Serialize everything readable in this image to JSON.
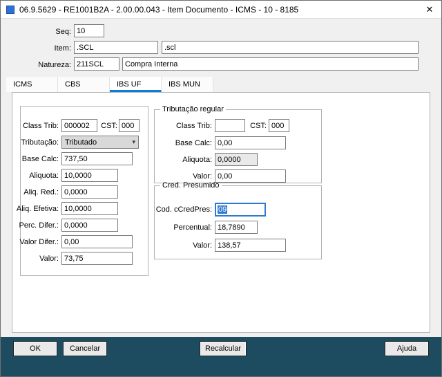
{
  "window": {
    "title": "06.9.5629 - RE1001B2A - 2.00.00.043 - Item Documento - ICMS - 10 - 8185"
  },
  "icons": {
    "close": "✕",
    "dropdown_arrow": "▾"
  },
  "colors": {
    "footer_bg": "#1d4b5f",
    "tab_accent": "#0c7cd8",
    "focus_blue": "#2e7ad1",
    "app_icon_blue": "#2f6fd6"
  },
  "header": {
    "seq": {
      "label": "Seq:",
      "value": "10"
    },
    "item": {
      "label": "Item:",
      "code": ".SCL",
      "description": ".scl"
    },
    "natureza": {
      "label": "Natureza:",
      "code": "211SCL",
      "description": "Compra Interna"
    }
  },
  "tabs": [
    {
      "label": "ICMS",
      "active": false
    },
    {
      "label": "CBS",
      "active": false
    },
    {
      "label": "IBS UF",
      "active": true
    },
    {
      "label": "IBS MUN",
      "active": false
    }
  ],
  "main_group": {
    "class_trib": {
      "label": "Class Trib:",
      "value": "000002"
    },
    "cst": {
      "label": "CST:",
      "value": "000"
    },
    "tributacao": {
      "label": "Tributação:",
      "value": "Tributado"
    },
    "base_calc": {
      "label": "Base Calc:",
      "value": "737,50"
    },
    "aliquota": {
      "label": "Aliquota:",
      "value": "10,0000"
    },
    "aliq_red": {
      "label": "Aliq. Red.:",
      "value": "0,0000"
    },
    "aliq_efetiva": {
      "label": "Aliq. Efetiva:",
      "value": "10,0000"
    },
    "perc_difer": {
      "label": "Perc. Difer.:",
      "value": "0,0000"
    },
    "valor_difer": {
      "label": "Valor Difer.:",
      "value": "0,00"
    },
    "valor": {
      "label": "Valor:",
      "value": "73,75"
    }
  },
  "tributacao_regular": {
    "title": "Tributação regular",
    "class_trib": {
      "label": "Class Trib:",
      "value": ""
    },
    "cst": {
      "label": "CST:",
      "value": "000"
    },
    "base_calc": {
      "label": "Base Calc:",
      "value": "0,00"
    },
    "aliquota": {
      "label": "Aliquota:",
      "value": "0,0000"
    },
    "valor": {
      "label": "Valor:",
      "value": "0,00"
    }
  },
  "cred_presumido": {
    "title": "Cred. Presumido",
    "cod_ccredpres": {
      "label": "Cod. cCredPres:",
      "value": "09"
    },
    "percentual": {
      "label": "Percentual:",
      "value": "18,7890"
    },
    "valor": {
      "label": "Valor:",
      "value": "138,57"
    }
  },
  "footer": {
    "ok": "OK",
    "cancelar": "Cancelar",
    "recalcular": "Recalcular",
    "ajuda": "Ajuda"
  }
}
